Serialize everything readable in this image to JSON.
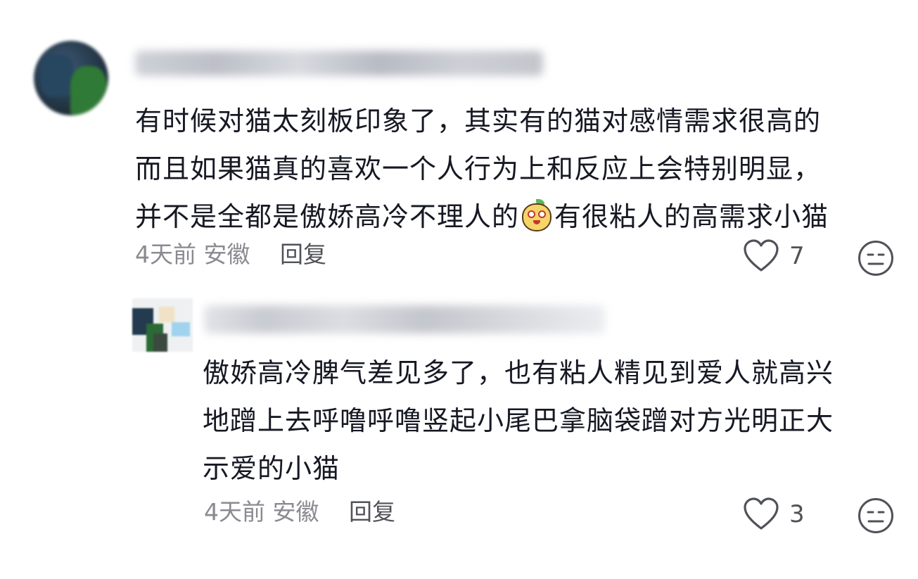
{
  "comments": [
    {
      "avatar": "blurred-avatar",
      "username": "blurred",
      "text_lines": [
        "有时候对猫太刻板印象了，其实有的猫对感情需求很高的",
        "而且如果猫真的喜欢一个人行为上和反应上会特别明显，",
        "并不是全都是傲娇高冷不理人的",
        "有很粘人的高需求小猫"
      ],
      "emoji": "cute-face-emoji",
      "time": "4天前",
      "location": "安徽",
      "reply_label": "回复",
      "likes": "7"
    },
    {
      "avatar": "blurred-avatar",
      "username": "blurred",
      "text_lines": [
        "傲娇高冷脾气差见多了，也有粘人精见到爱人就高兴",
        "地蹭上去呼噜呼噜竖起小尾巴拿脑袋蹭对方光明正大",
        "示爱的小猫"
      ],
      "time": "4天前",
      "location": "安徽",
      "reply_label": "回复",
      "likes": "3"
    }
  ],
  "icons": {
    "like": "heart-outline-icon",
    "dislike": "meh-face-icon"
  },
  "colors": {
    "text": "#161823",
    "meta": "#8a8b91",
    "icon": "#505259"
  }
}
